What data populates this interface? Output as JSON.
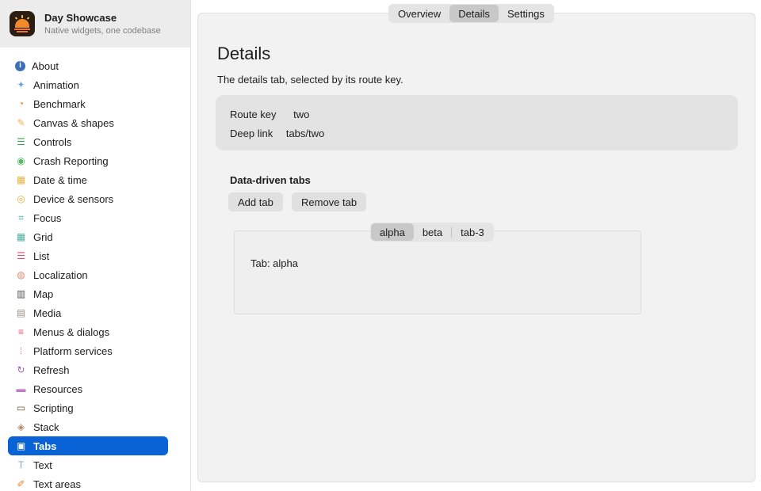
{
  "app": {
    "name": "Day Showcase",
    "subtitle": "Native widgets, one codebase"
  },
  "sidebar": {
    "items": [
      {
        "label": "About",
        "icon": "info-icon",
        "color": "#3d6fb6"
      },
      {
        "label": "Animation",
        "icon": "sparkle-icon",
        "color": "#6aa6e0"
      },
      {
        "label": "Benchmark",
        "icon": "gauge-icon",
        "color": "#f0812d"
      },
      {
        "label": "Canvas & shapes",
        "icon": "pencil-icon",
        "color": "#f2b046"
      },
      {
        "label": "Controls",
        "icon": "sliders-icon",
        "color": "#3fa55c"
      },
      {
        "label": "Crash Reporting",
        "icon": "broadcast-icon",
        "color": "#58b868"
      },
      {
        "label": "Date & time",
        "icon": "calendar-icon",
        "color": "#e8b33d"
      },
      {
        "label": "Device & sensors",
        "icon": "sensor-icon",
        "color": "#e8b33d"
      },
      {
        "label": "Focus",
        "icon": "focus-icon",
        "color": "#3faa9a"
      },
      {
        "label": "Grid",
        "icon": "grid-icon",
        "color": "#4caea0"
      },
      {
        "label": "List",
        "icon": "list-icon",
        "color": "#e0506a"
      },
      {
        "label": "Localization",
        "icon": "globe-icon",
        "color": "#f0886a"
      },
      {
        "label": "Map",
        "icon": "map-icon",
        "color": "#555555"
      },
      {
        "label": "Media",
        "icon": "clapper-icon",
        "color": "#9a8f86"
      },
      {
        "label": "Menus & dialogs",
        "icon": "menu-icon",
        "color": "#e0506a"
      },
      {
        "label": "Platform services",
        "icon": "dots-grid-icon",
        "color": "#e87a8a"
      },
      {
        "label": "Refresh",
        "icon": "refresh-icon",
        "color": "#9a5fb0"
      },
      {
        "label": "Resources",
        "icon": "folder-icon",
        "color": "#c07ac6"
      },
      {
        "label": "Scripting",
        "icon": "terminal-icon",
        "color": "#7a5a4a"
      },
      {
        "label": "Stack",
        "icon": "layers-icon",
        "color": "#b08a6a"
      },
      {
        "label": "Tabs",
        "icon": "tabs-icon",
        "color": "#ffffff",
        "active": true
      },
      {
        "label": "Text",
        "icon": "text-icon",
        "color": "#7aa8d8"
      },
      {
        "label": "Text areas",
        "icon": "note-icon",
        "color": "#f0812d"
      }
    ]
  },
  "top_tabs": [
    {
      "label": "Overview",
      "selected": false
    },
    {
      "label": "Details",
      "selected": true
    },
    {
      "label": "Settings",
      "selected": false
    }
  ],
  "page": {
    "title": "Details",
    "subtitle": "The details tab, selected by its route key.",
    "route_key_label": "Route key",
    "route_key_value": "two",
    "deep_link_label": "Deep link",
    "deep_link_value": "tabs/two"
  },
  "data_tabs": {
    "title": "Data-driven tabs",
    "add_label": "Add tab",
    "remove_label": "Remove tab",
    "tabs": [
      {
        "label": "alpha",
        "selected": true
      },
      {
        "label": "beta",
        "selected": false
      },
      {
        "label": "tab-3",
        "selected": false
      }
    ],
    "content": "Tab: alpha"
  },
  "colors": {
    "accent": "#0a63d6",
    "panel": "#f2f2f2",
    "info_box": "#e3e3e3"
  }
}
